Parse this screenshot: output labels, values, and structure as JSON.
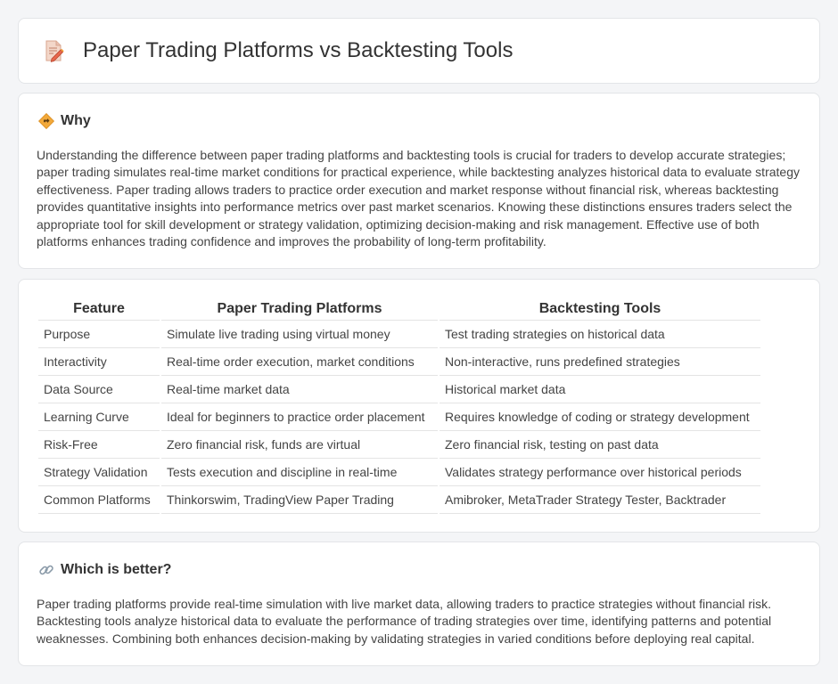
{
  "header": {
    "title": "Paper Trading Platforms vs Backtesting Tools",
    "icon": "document-pencil-icon"
  },
  "why": {
    "title": "Why",
    "icon": "diamond-direction-icon",
    "text": "Understanding the difference between paper trading platforms and backtesting tools is crucial for traders to develop accurate strategies; paper trading simulates real-time market conditions for practical experience, while backtesting analyzes historical data to evaluate strategy effectiveness. Paper trading allows traders to practice order execution and market response without financial risk, whereas backtesting provides quantitative insights into performance metrics over past market scenarios. Knowing these distinctions ensures traders select the appropriate tool for skill development or strategy validation, optimizing decision-making and risk management. Effective use of both platforms enhances trading confidence and improves the probability of long-term profitability."
  },
  "table": {
    "headers": [
      "Feature",
      "Paper Trading Platforms",
      "Backtesting Tools"
    ],
    "rows": [
      [
        "Purpose",
        "Simulate live trading using virtual money",
        "Test trading strategies on historical data"
      ],
      [
        "Interactivity",
        "Real-time order execution, market conditions",
        "Non-interactive, runs predefined strategies"
      ],
      [
        "Data Source",
        "Real-time market data",
        "Historical market data"
      ],
      [
        "Learning Curve",
        "Ideal for beginners to practice order placement",
        "Requires knowledge of coding or strategy development"
      ],
      [
        "Risk-Free",
        "Zero financial risk, funds are virtual",
        "Zero financial risk, testing on past data"
      ],
      [
        "Strategy Validation",
        "Tests execution and discipline in real-time",
        "Validates strategy performance over historical periods"
      ],
      [
        "Common Platforms",
        "Thinkorswim, TradingView Paper Trading",
        "Amibroker, MetaTrader Strategy Tester, Backtrader"
      ]
    ]
  },
  "better": {
    "title": "Which is better?",
    "icon": "link-icon",
    "text": "Paper trading platforms provide real-time simulation with live market data, allowing traders to practice strategies without financial risk. Backtesting tools analyze historical data to evaluate the performance of trading strategies over time, identifying patterns and potential weaknesses. Combining both enhances decision-making by validating strategies in varied conditions before deploying real capital."
  }
}
